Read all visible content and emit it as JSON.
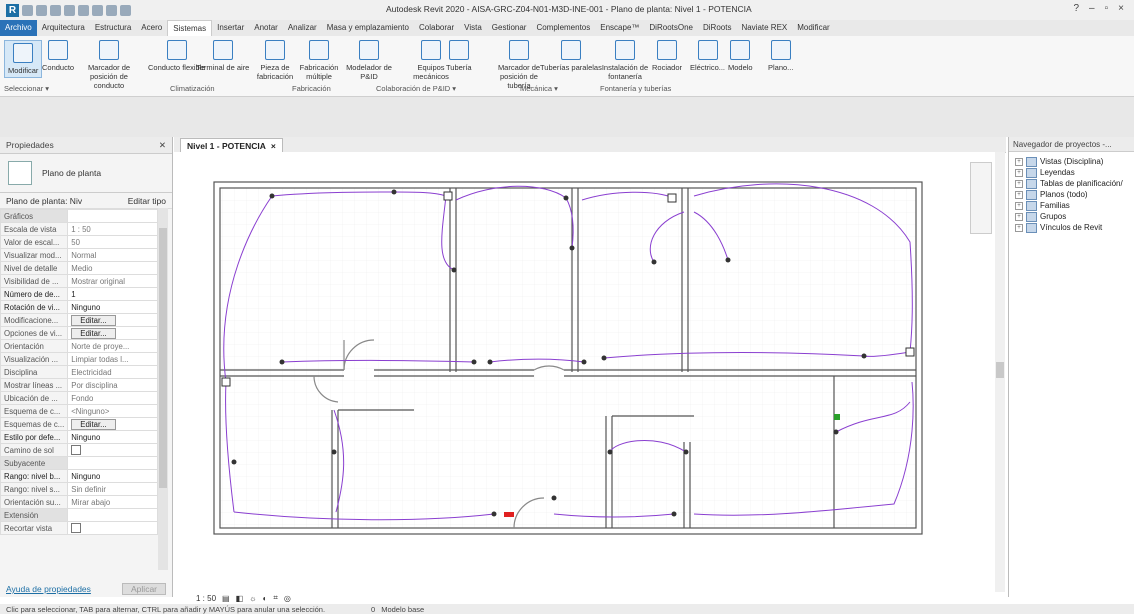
{
  "app": {
    "window_title": "Autodesk Revit 2020 - AISA-GRC-Z04-N01-M3D-INE-001 - Plano de planta: Nivel 1 - POTENCIA",
    "logo": "R"
  },
  "ribbon_tabs": [
    "Archivo",
    "Arquitectura",
    "Estructura",
    "Acero",
    "Sistemas",
    "Insertar",
    "Anotar",
    "Analizar",
    "Masa y emplazamiento",
    "Colaborar",
    "Vista",
    "Gestionar",
    "Complementos",
    "Enscape™",
    "DiRootsOne",
    "DiRoots",
    "Naviate REX",
    "Modificar"
  ],
  "ribbon_active": "Sistemas",
  "ribbon_buttons": [
    {
      "label": "Modificar"
    },
    {
      "label": "Conducto"
    },
    {
      "label": "Marcador de posición de conducto"
    },
    {
      "label": "Conducto flexible"
    },
    {
      "label": "Terminal de aire"
    },
    {
      "label": "Pieza de fabricación"
    },
    {
      "label": "Fabricación múltiple"
    },
    {
      "label": "Modelador de P&ID"
    },
    {
      "label": "Equipos mecánicos"
    },
    {
      "label": "Tubería"
    },
    {
      "label": "Marcador de posición de tubería"
    },
    {
      "label": "Tuberías paralelas"
    },
    {
      "label": "Instalación de fontanería"
    },
    {
      "label": "Rociador"
    },
    {
      "label": "Eléctrico..."
    },
    {
      "label": "Modelo"
    },
    {
      "label": "Plano..."
    }
  ],
  "ribbon_panels": [
    "Seleccionar ▾",
    "Climatización",
    "Fabricación",
    "Colaboración de P&ID ▾",
    "Mecánica ▾",
    "Fontanería y tuberías"
  ],
  "properties": {
    "title": "Propiedades",
    "type_name": "Plano de planta",
    "instance_label": "Plano de planta: Niv",
    "edit_type": "Editar tipo",
    "rows": [
      {
        "k": "Gráficos",
        "v": "",
        "group": true
      },
      {
        "k": "Escala de vista",
        "v": "1 : 50"
      },
      {
        "k": "Valor de escal...",
        "v": "50"
      },
      {
        "k": "Visualizar mod...",
        "v": "Normal"
      },
      {
        "k": "Nivel de detalle",
        "v": "Medio"
      },
      {
        "k": "Visibilidad de ...",
        "v": "Mostrar original"
      },
      {
        "k": "Número de de...",
        "v": "1",
        "bold": true
      },
      {
        "k": "Rotación de vi...",
        "v": "Ninguno",
        "bold": true
      },
      {
        "k": "Modificacione...",
        "v": "Editar...",
        "button": true
      },
      {
        "k": "Opciones de vi...",
        "v": "Editar...",
        "button": true
      },
      {
        "k": "Orientación",
        "v": "Norte de proye..."
      },
      {
        "k": "Visualización ...",
        "v": "Limpiar todas l..."
      },
      {
        "k": "Disciplina",
        "v": "Electricidad"
      },
      {
        "k": "Mostrar líneas ...",
        "v": "Por disciplina"
      },
      {
        "k": "Ubicación de ...",
        "v": "Fondo"
      },
      {
        "k": "Esquema de c...",
        "v": "<Ninguno>"
      },
      {
        "k": "Esquemas de c...",
        "v": "Editar...",
        "button": true
      },
      {
        "k": "Estilo por defe...",
        "v": "Ninguno",
        "bold": true
      },
      {
        "k": "Camino de sol",
        "v": "",
        "checkbox": true
      },
      {
        "k": "Subyacente",
        "v": "",
        "group": true
      },
      {
        "k": "Rango: nivel b...",
        "v": "Ninguno",
        "bold": true
      },
      {
        "k": "Rango: nivel s...",
        "v": "Sin definir"
      },
      {
        "k": "Orientación su...",
        "v": "Mirar abajo"
      },
      {
        "k": "Extensión",
        "v": "",
        "group": true
      },
      {
        "k": "Recortar vista",
        "v": "",
        "checkbox": true
      }
    ],
    "help_link": "Ayuda de propiedades",
    "apply": "Aplicar"
  },
  "view_tab": {
    "label": "Nivel 1 - POTENCIA",
    "close": "×"
  },
  "view_controls": {
    "scale": "1 : 50"
  },
  "browser": {
    "title": "Navegador de proyectos -...",
    "items": [
      "Vistas (Disciplina)",
      "Leyendas",
      "Tablas de planificación/",
      "Planos (todo)",
      "Familias",
      "Grupos",
      "Vínculos de Revit"
    ]
  },
  "status": {
    "hint": "Clic para seleccionar, TAB para alternar, CTRL para añadir y MAYÚS para anular una selección.",
    "model": "Modelo base",
    "zero": "0"
  },
  "colors": {
    "wire": "#8a3fd0",
    "accent": "#2a72b8",
    "wall": "#555555"
  }
}
